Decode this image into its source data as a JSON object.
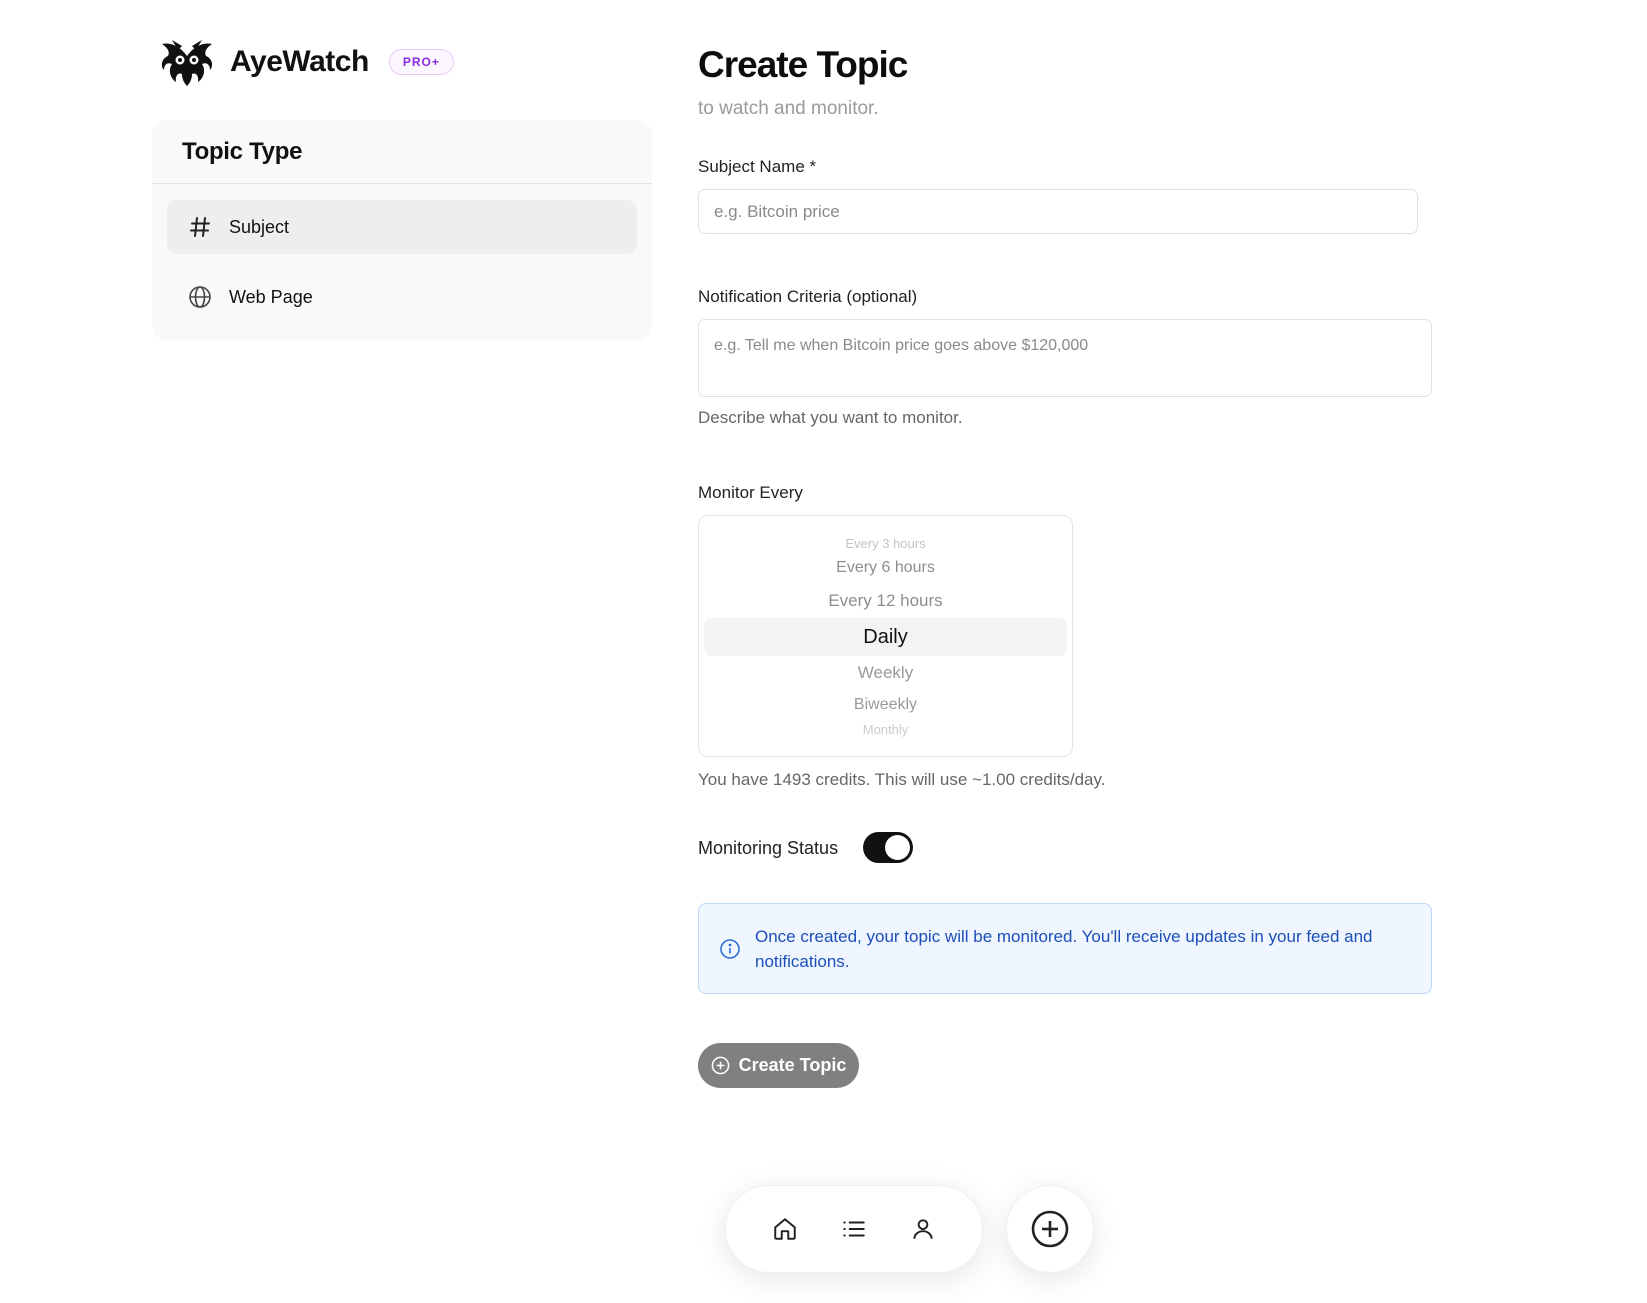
{
  "brand": {
    "name": "AyeWatch",
    "badge": "PRO+",
    "logo_icon": "owl-logo-icon"
  },
  "topic_type": {
    "title": "Topic Type",
    "items": [
      {
        "label": "Subject",
        "icon": "hash-icon",
        "active": true
      },
      {
        "label": "Web Page",
        "icon": "globe-icon",
        "active": false
      }
    ]
  },
  "form": {
    "title": "Create Topic",
    "subtitle": "to watch and monitor.",
    "subject_name": {
      "label": "Subject Name *",
      "value": "",
      "placeholder": "e.g. Bitcoin price"
    },
    "criteria": {
      "label": "Notification Criteria (optional)",
      "value": "",
      "placeholder": "e.g. Tell me when Bitcoin price goes above $120,000",
      "help": "Describe what you want to monitor."
    },
    "monitor_every": {
      "label": "Monitor Every",
      "options": [
        "Every 3 hours",
        "Every 6 hours",
        "Every 12 hours",
        "Daily",
        "Weekly",
        "Biweekly",
        "Monthly"
      ],
      "selected": "Daily"
    },
    "credits_text": "You have 1493 credits. This will use ~1.00 credits/day.",
    "monitoring_status": {
      "label": "Monitoring Status",
      "on": true
    },
    "info": {
      "icon": "info-icon",
      "text": "Once created, your topic will be monitored. You'll receive updates in your feed and notifications."
    },
    "submit_label": "Create Topic"
  },
  "bottom_nav": {
    "items": [
      {
        "icon": "home-icon"
      },
      {
        "icon": "list-icon"
      },
      {
        "icon": "user-icon"
      }
    ],
    "fab_icon": "plus-circle-icon"
  },
  "colors": {
    "accent": "#111111",
    "badge": "#8a2be2",
    "info_text": "#1d4fb8",
    "info_bg": "#eff6ff",
    "button_disabled": "#808080"
  }
}
